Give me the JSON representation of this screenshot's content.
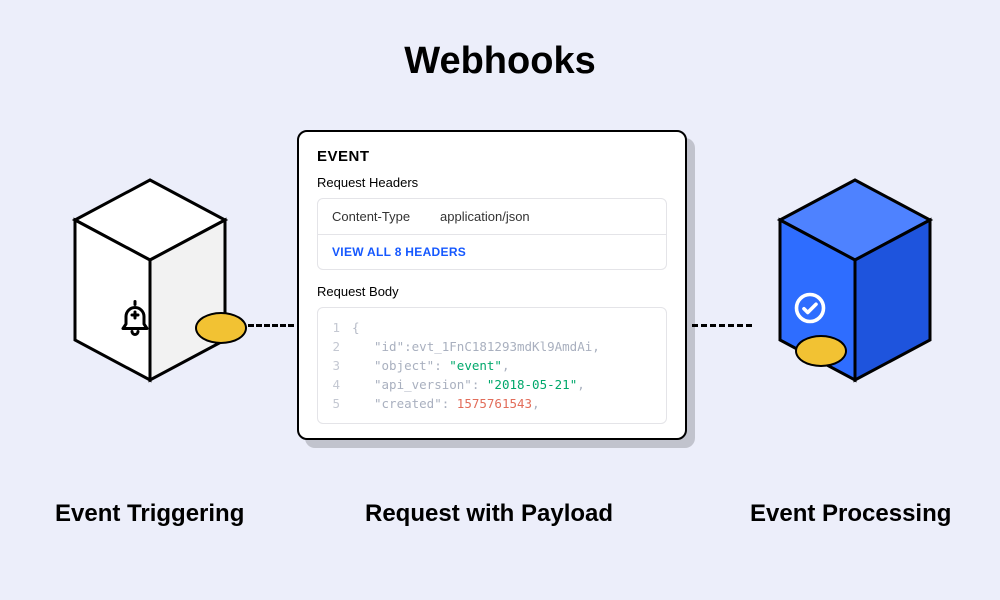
{
  "title": "Webhooks",
  "labels": {
    "left": "Event Triggering",
    "center": "Request with Payload",
    "right": "Event Processing"
  },
  "card": {
    "title": "EVENT",
    "request_headers_label": "Request Headers",
    "header": {
      "key": "Content-Type",
      "value": "application/json"
    },
    "view_all": "VIEW ALL 8 HEADERS",
    "request_body_label": "Request Body",
    "body_lines": [
      {
        "n": "1",
        "text": "{"
      },
      {
        "n": "2",
        "key": "\"id\"",
        "sep": ":",
        "val": "evt_1FnC181293mdKl9AmdAi",
        "trail": ","
      },
      {
        "n": "3",
        "key": "\"object\"",
        "sep": ": ",
        "str": "\"event\"",
        "trail": ","
      },
      {
        "n": "4",
        "key": "\"api_version\"",
        "sep": ": ",
        "str": "\"2018-05-21\"",
        "trail": ","
      },
      {
        "n": "5",
        "key": "\"created\"",
        "sep": ": ",
        "num": "1575761543",
        "trail": ","
      }
    ]
  },
  "icons": {
    "left_cube": "bell-plus-icon",
    "right_cube": "check-circle-icon"
  },
  "colors": {
    "page_bg": "#eceefa",
    "blue_cube": "#2e6dff",
    "blue_cube_top": "#4e82ff",
    "blue_cube_side": "#1e54dd",
    "coin": "#f2c233",
    "link_blue": "#1558ff",
    "json_string": "#00a86b",
    "json_number": "#e26d5a"
  }
}
